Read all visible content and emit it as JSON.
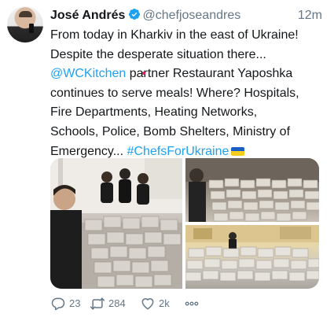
{
  "tweet": {
    "author_name": "José Andrés",
    "verified_icon": "verified-badge-icon",
    "handle": "@chefjoseandres",
    "time": "12m",
    "lines": [
      "From today in Kharkiv in the east of Ukraine!",
      "Despite the desperate situation there...",
      "partner Restaurant Yaposhka",
      "continues to serve meals! Where? Hospitals,",
      "Fire Departments, Heating Networks,",
      "Schools, Police, Bomb Shelters, Ministry of",
      "Emergency..."
    ],
    "mention": "@WCKitchen",
    "hashtag": "#ChefsForUkraine",
    "flag_icon": "ukraine-flag-icon",
    "link_color": "#1da1f2",
    "text_color": "#14171a",
    "muted_color": "#657786"
  },
  "actions": {
    "replies": "23",
    "retweets": "284",
    "likes": "2k",
    "reply_icon": "reply-icon",
    "retweet_icon": "retweet-icon",
    "like_icon": "heart-icon",
    "more_icon": "more-icon"
  }
}
